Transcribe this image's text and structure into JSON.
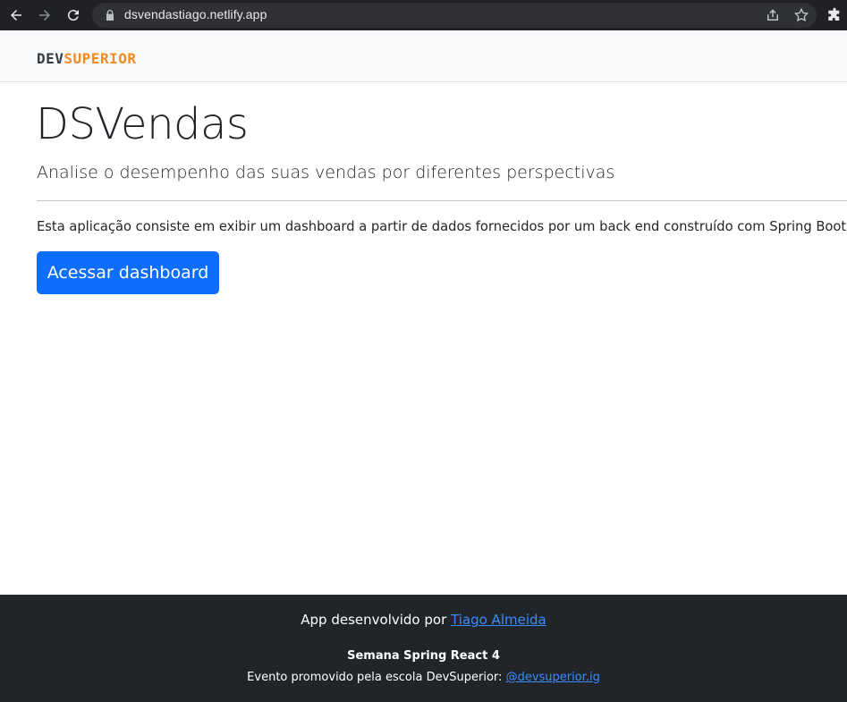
{
  "browser": {
    "url": "dsvendastiago.netlify.app"
  },
  "header": {
    "logo_dev": "DEV",
    "logo_superior": "SUPERIOR"
  },
  "main": {
    "title": "DSVendas",
    "subtitle": "Analise o desempenho das suas vendas por diferentes perspectivas",
    "description": "Esta aplicação consiste em exibir um dashboard a partir de dados fornecidos por um back end construído com Spring Boot.",
    "button_label": "Acessar dashboard"
  },
  "footer": {
    "credit_prefix": "App desenvolvido por",
    "credit_link": "Tiago Almeida",
    "event_title": "Semana Spring React 4",
    "event_prefix": "Evento promovido pela escola DevSuperior:",
    "event_link": "@devsuperior.ig"
  },
  "colors": {
    "accent": "#0d6efd",
    "brand_orange": "#f58a1f",
    "footer_bg": "#212529"
  }
}
